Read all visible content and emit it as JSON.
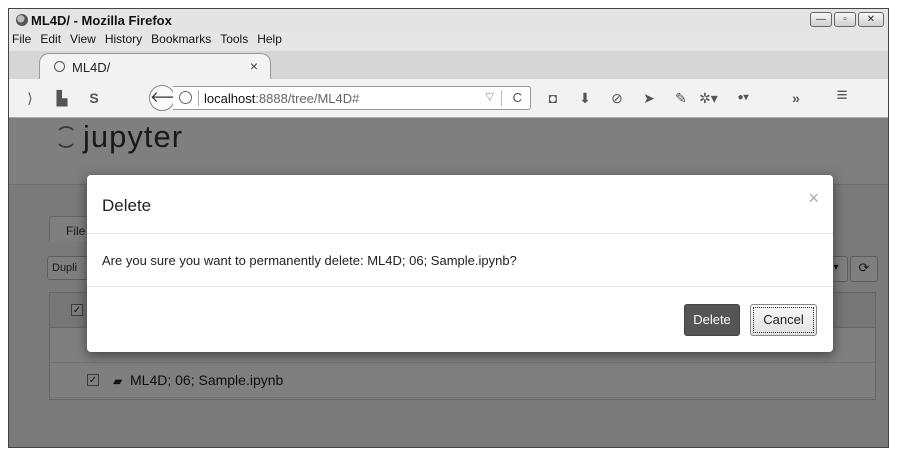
{
  "window": {
    "title": "ML4D/ - Mozilla Firefox"
  },
  "menu": [
    "File",
    "Edit",
    "View",
    "History",
    "Bookmarks",
    "Tools",
    "Help"
  ],
  "tab": {
    "label": "ML4D/",
    "close": "×"
  },
  "toolbar": {
    "url_host": "localhost",
    "url_path": ":8888/tree/ML4D#",
    "left_icons": [
      "rss-icon",
      "print-icon",
      "skype-icon"
    ],
    "right_icons": [
      "pocket-icon",
      "download-icon",
      "block-icon",
      "send-icon",
      "feather-icon",
      "gear-icon",
      "abp-icon",
      "overflow-icon",
      "hamburger-menu-icon"
    ]
  },
  "jupyter": {
    "logo": "jupyter",
    "files_tab": "File",
    "duplicate_button": "Dupli"
  },
  "file_list": {
    "rows": [
      {
        "name": "ML4D; 06; Sample.ipynb"
      }
    ]
  },
  "modal": {
    "title": "Delete",
    "close": "×",
    "message": "Are you sure you want to permanently delete: ML4D; 06; Sample.ipynb?",
    "delete_label": "Delete",
    "cancel_label": "Cancel"
  }
}
